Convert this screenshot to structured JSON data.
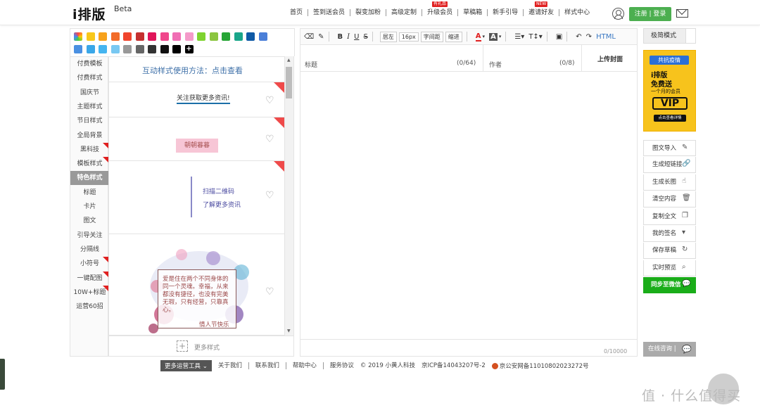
{
  "header": {
    "logo": "i排版",
    "logo_beta": "Beta",
    "nav": [
      {
        "label": "首页"
      },
      {
        "label": "签到送会员"
      },
      {
        "label": "裂变加粉"
      },
      {
        "label": "高级定制"
      },
      {
        "label": "升级会员",
        "tag": "有礼品"
      },
      {
        "label": "草稿箱"
      },
      {
        "label": "新手引导"
      },
      {
        "label": "邀请好友",
        "tag": "NEW"
      },
      {
        "label": "样式中心"
      }
    ],
    "register_label": "注册 | 登录"
  },
  "palette": {
    "colors": [
      "#f5a623",
      "#f8c81b",
      "#f7a21c",
      "#f26c29",
      "#f0452d",
      "#c53030",
      "#e0155a",
      "#f0478c",
      "#f06eb4",
      "#f49ac9",
      "#7ed32f",
      "#8bc540",
      "#27a536",
      "#1aa68a",
      "#0f5aa6",
      "#4a7fd8",
      "#4a90e2",
      "#3aa7e8",
      "#45b5f0",
      "#78c8f2",
      "#999999",
      "#666666",
      "#333333",
      "#111111",
      "#000000"
    ],
    "plus": "+"
  },
  "left_nav": {
    "items": [
      "付费模板",
      "付费样式",
      "国庆节",
      "主题样式",
      "节日样式",
      "全局背景",
      "黑科技",
      "模板样式",
      "特色样式",
      "标题",
      "卡片",
      "图文",
      "引导关注",
      "分隔线",
      "小符号",
      "一键配图",
      "10W+标题",
      "运营60招"
    ],
    "active": "特色样式"
  },
  "styles": {
    "top_link": "互动样式使用方法：点击查看",
    "card1_text": "关注获取更多资讯!",
    "card2_text": "朝朝暮暮",
    "card3_line1": "扫描二维码",
    "card3_line2": "了解更多资讯",
    "card4_text": "爱是住在两个不同身体的同一个灵魂。幸福，从来都没有捷径，也没有完美无瑕，只有经营，只靠真心。",
    "card4_sign": "情人节快乐",
    "more_label": "更多样式",
    "more_plus": "+"
  },
  "toolbar": {
    "items": [
      "B",
      "I",
      "U",
      "S"
    ],
    "align_label": "居左",
    "size_label": "16px",
    "spacing_label": "字间距",
    "indent_label": "缩进",
    "font_color": "A",
    "bg_color": "A",
    "html_label": "HTML",
    "undo": "↶",
    "redo": "↷"
  },
  "editor": {
    "title_label": "标题",
    "title_count": "(0/64)",
    "author_label": "作者",
    "author_count": "(0/8)",
    "cover_label": "上传封面",
    "word_count": "0/10000"
  },
  "right_panel": {
    "mode_label": "极简模式",
    "promo_line1": "共抗疫情",
    "promo_line2": "i排版",
    "promo_line3": "免费送",
    "promo_line4": "一个月的会员",
    "promo_line5": "VIP",
    "promo_line6": "点击查看详情",
    "buttons": [
      {
        "label": "图文导入",
        "icon": "edit-icon"
      },
      {
        "label": "生成短链接",
        "icon": "link-icon"
      },
      {
        "label": "生成长图",
        "icon": "hand-icon"
      },
      {
        "label": "清空内容",
        "icon": "trash-icon"
      },
      {
        "label": "复制全文",
        "icon": "copy-icon"
      },
      {
        "label": "我的签名",
        "icon": "caret-down-icon"
      },
      {
        "label": "保存草稿",
        "icon": "refresh-icon"
      },
      {
        "label": "实时预览",
        "icon": "preview-icon"
      },
      {
        "label": "同步至微信",
        "icon": "wechat-icon"
      }
    ],
    "consult_label": "在线咨询 |"
  },
  "footer": {
    "more_tools": "更多运营工具",
    "links": [
      "关于我们",
      "联系我们",
      "帮助中心",
      "服务协议"
    ],
    "copyright": "© 2019 小黄人科技",
    "icp": "京ICP备14043207号-2",
    "police": "京公安网备11010802023272号"
  },
  "watermark": "值 · 什么值得买",
  "colors": {
    "accent_green": "#4caf50",
    "wechat_green": "#1aad19",
    "flag_red": "#e02020",
    "promo_yellow": "#f7c31c"
  }
}
